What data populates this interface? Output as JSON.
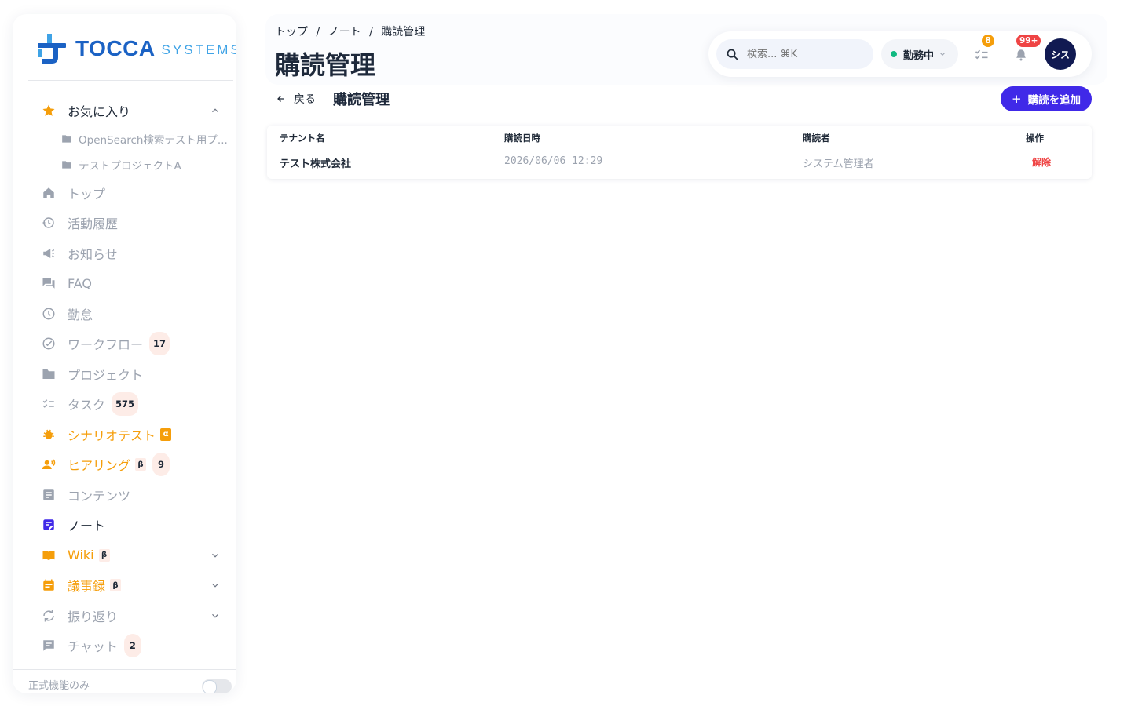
{
  "brand": {
    "name": "TOCCA",
    "sub": "SYSTEMS"
  },
  "sidebar": {
    "favorites": {
      "label": "お気に入り",
      "items": [
        {
          "label": "OpenSearch検索テスト用プ..."
        },
        {
          "label": "テストプロジェクトA"
        }
      ]
    },
    "items": [
      {
        "label": "トップ"
      },
      {
        "label": "活動履歴"
      },
      {
        "label": "お知らせ"
      },
      {
        "label": "FAQ"
      },
      {
        "label": "勤怠"
      },
      {
        "label": "ワークフロー",
        "count": "17"
      },
      {
        "label": "プロジェクト"
      },
      {
        "label": "タスク",
        "count": "575"
      },
      {
        "label": "シナリオテスト",
        "tag": "α"
      },
      {
        "label": "ヒアリング",
        "tag": "β",
        "count": "9"
      },
      {
        "label": "コンテンツ"
      },
      {
        "label": "ノート"
      },
      {
        "label": "Wiki",
        "tag": "β"
      },
      {
        "label": "議事録",
        "tag": "β"
      },
      {
        "label": "振り返り"
      },
      {
        "label": "チャット",
        "count": "2"
      }
    ],
    "footer_label": "正式機能のみ"
  },
  "header": {
    "breadcrumb": [
      "トップ",
      "/",
      "ノート",
      "/",
      "購読管理"
    ],
    "title": "購読管理",
    "search_placeholder": "検索... ⌘K",
    "status": "勤務中",
    "tasks_badge": "8",
    "notifications_badge": "99+",
    "avatar": "シス"
  },
  "content": {
    "back_label": "戻る",
    "title": "購読管理",
    "add_button": "購読を追加",
    "plus": "+",
    "table": {
      "headers": [
        "テナント名",
        "購読日時",
        "購読者",
        "操作"
      ],
      "rows": [
        {
          "tenant": "テスト株式会社",
          "date": "2026/06/06 12:29",
          "user": "システム管理者",
          "action": "解除"
        }
      ]
    }
  },
  "colors": {
    "accent": "#4029e8",
    "brand": "#1b62c4",
    "danger": "#ef4444",
    "warning": "#f59e0b",
    "online": "#10b981"
  }
}
